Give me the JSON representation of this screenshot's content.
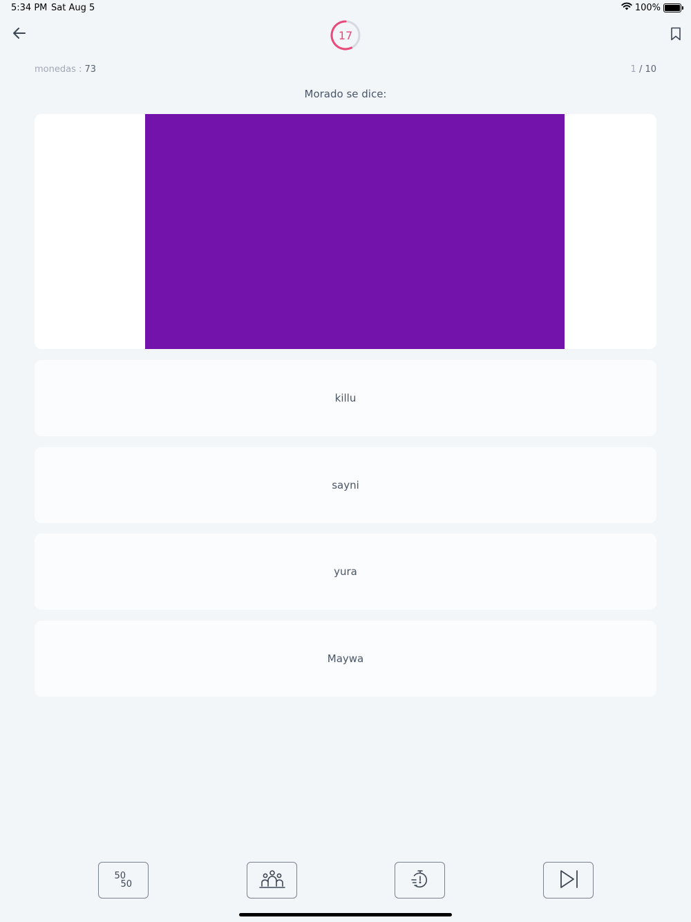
{
  "status_bar": {
    "time": "5:34 PM",
    "date": "Sat Aug 5",
    "battery": "100%"
  },
  "header": {
    "timer_value": "17",
    "timer_fraction_remaining": 0.57,
    "accent_color": "#e84a7a"
  },
  "stats": {
    "coins_label": "monedas : ",
    "coins_value": "73",
    "progress_current": "1",
    "progress_total": " / 10"
  },
  "question": {
    "text": "Morado se dice:",
    "swatch_color": "#7413ab"
  },
  "options": [
    "killu",
    "sayni",
    "yura",
    "Maywa"
  ],
  "lifelines": {
    "fifty_top": "50",
    "fifty_bottom": "50"
  },
  "icons": {
    "back": "arrow-left-icon",
    "bookmark": "bookmark-icon",
    "fifty_fifty": "fifty-fifty-icon",
    "audience": "audience-icon",
    "timer": "stopwatch-icon",
    "skip": "skip-next-icon"
  }
}
